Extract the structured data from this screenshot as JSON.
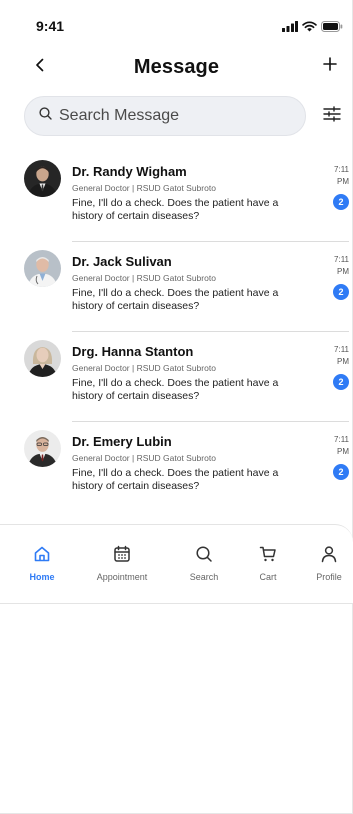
{
  "status_bar": {
    "time": "9:41"
  },
  "header": {
    "title": "Message",
    "back_icon": "chevron-left-icon",
    "add_icon": "plus-icon"
  },
  "search": {
    "placeholder": "Search Message",
    "value": ""
  },
  "colors": {
    "accent": "#2f7bf5",
    "text": "#111111",
    "muted": "#666666",
    "search_bg": "#eef0f4"
  },
  "messages": [
    {
      "name": "Dr. Randy Wigham",
      "subtitle": "General Doctor | RSUD Gatot Subroto",
      "preview": "Fine, I'll do a check. Does the patient have a history of certain diseases?",
      "time": "7:11 PM",
      "unread": "2"
    },
    {
      "name": "Dr. Jack Sulivan",
      "subtitle": "General Doctor | RSUD Gatot Subroto",
      "preview": "Fine, I'll do a check. Does the patient have a history of certain diseases?",
      "time": "7:11 PM",
      "unread": "2"
    },
    {
      "name": "Drg. Hanna Stanton",
      "subtitle": "General Doctor | RSUD Gatot Subroto",
      "preview": "Fine, I'll do a check. Does the patient have a history of certain diseases?",
      "time": "7:11 PM",
      "unread": "2"
    },
    {
      "name": "Dr. Emery Lubin",
      "subtitle": "General Doctor | RSUD Gatot Subroto",
      "preview": "Fine, I'll do a check. Does the patient have a history of certain diseases?",
      "time": "7:11 PM",
      "unread": "2"
    }
  ],
  "nav": [
    {
      "label": "Home",
      "icon": "home-icon",
      "active": true
    },
    {
      "label": "Appointment",
      "icon": "calendar-icon",
      "active": false
    },
    {
      "label": "Search",
      "icon": "search-icon",
      "active": false
    },
    {
      "label": "Cart",
      "icon": "cart-icon",
      "active": false
    },
    {
      "label": "Profile",
      "icon": "profile-icon",
      "active": false
    }
  ]
}
